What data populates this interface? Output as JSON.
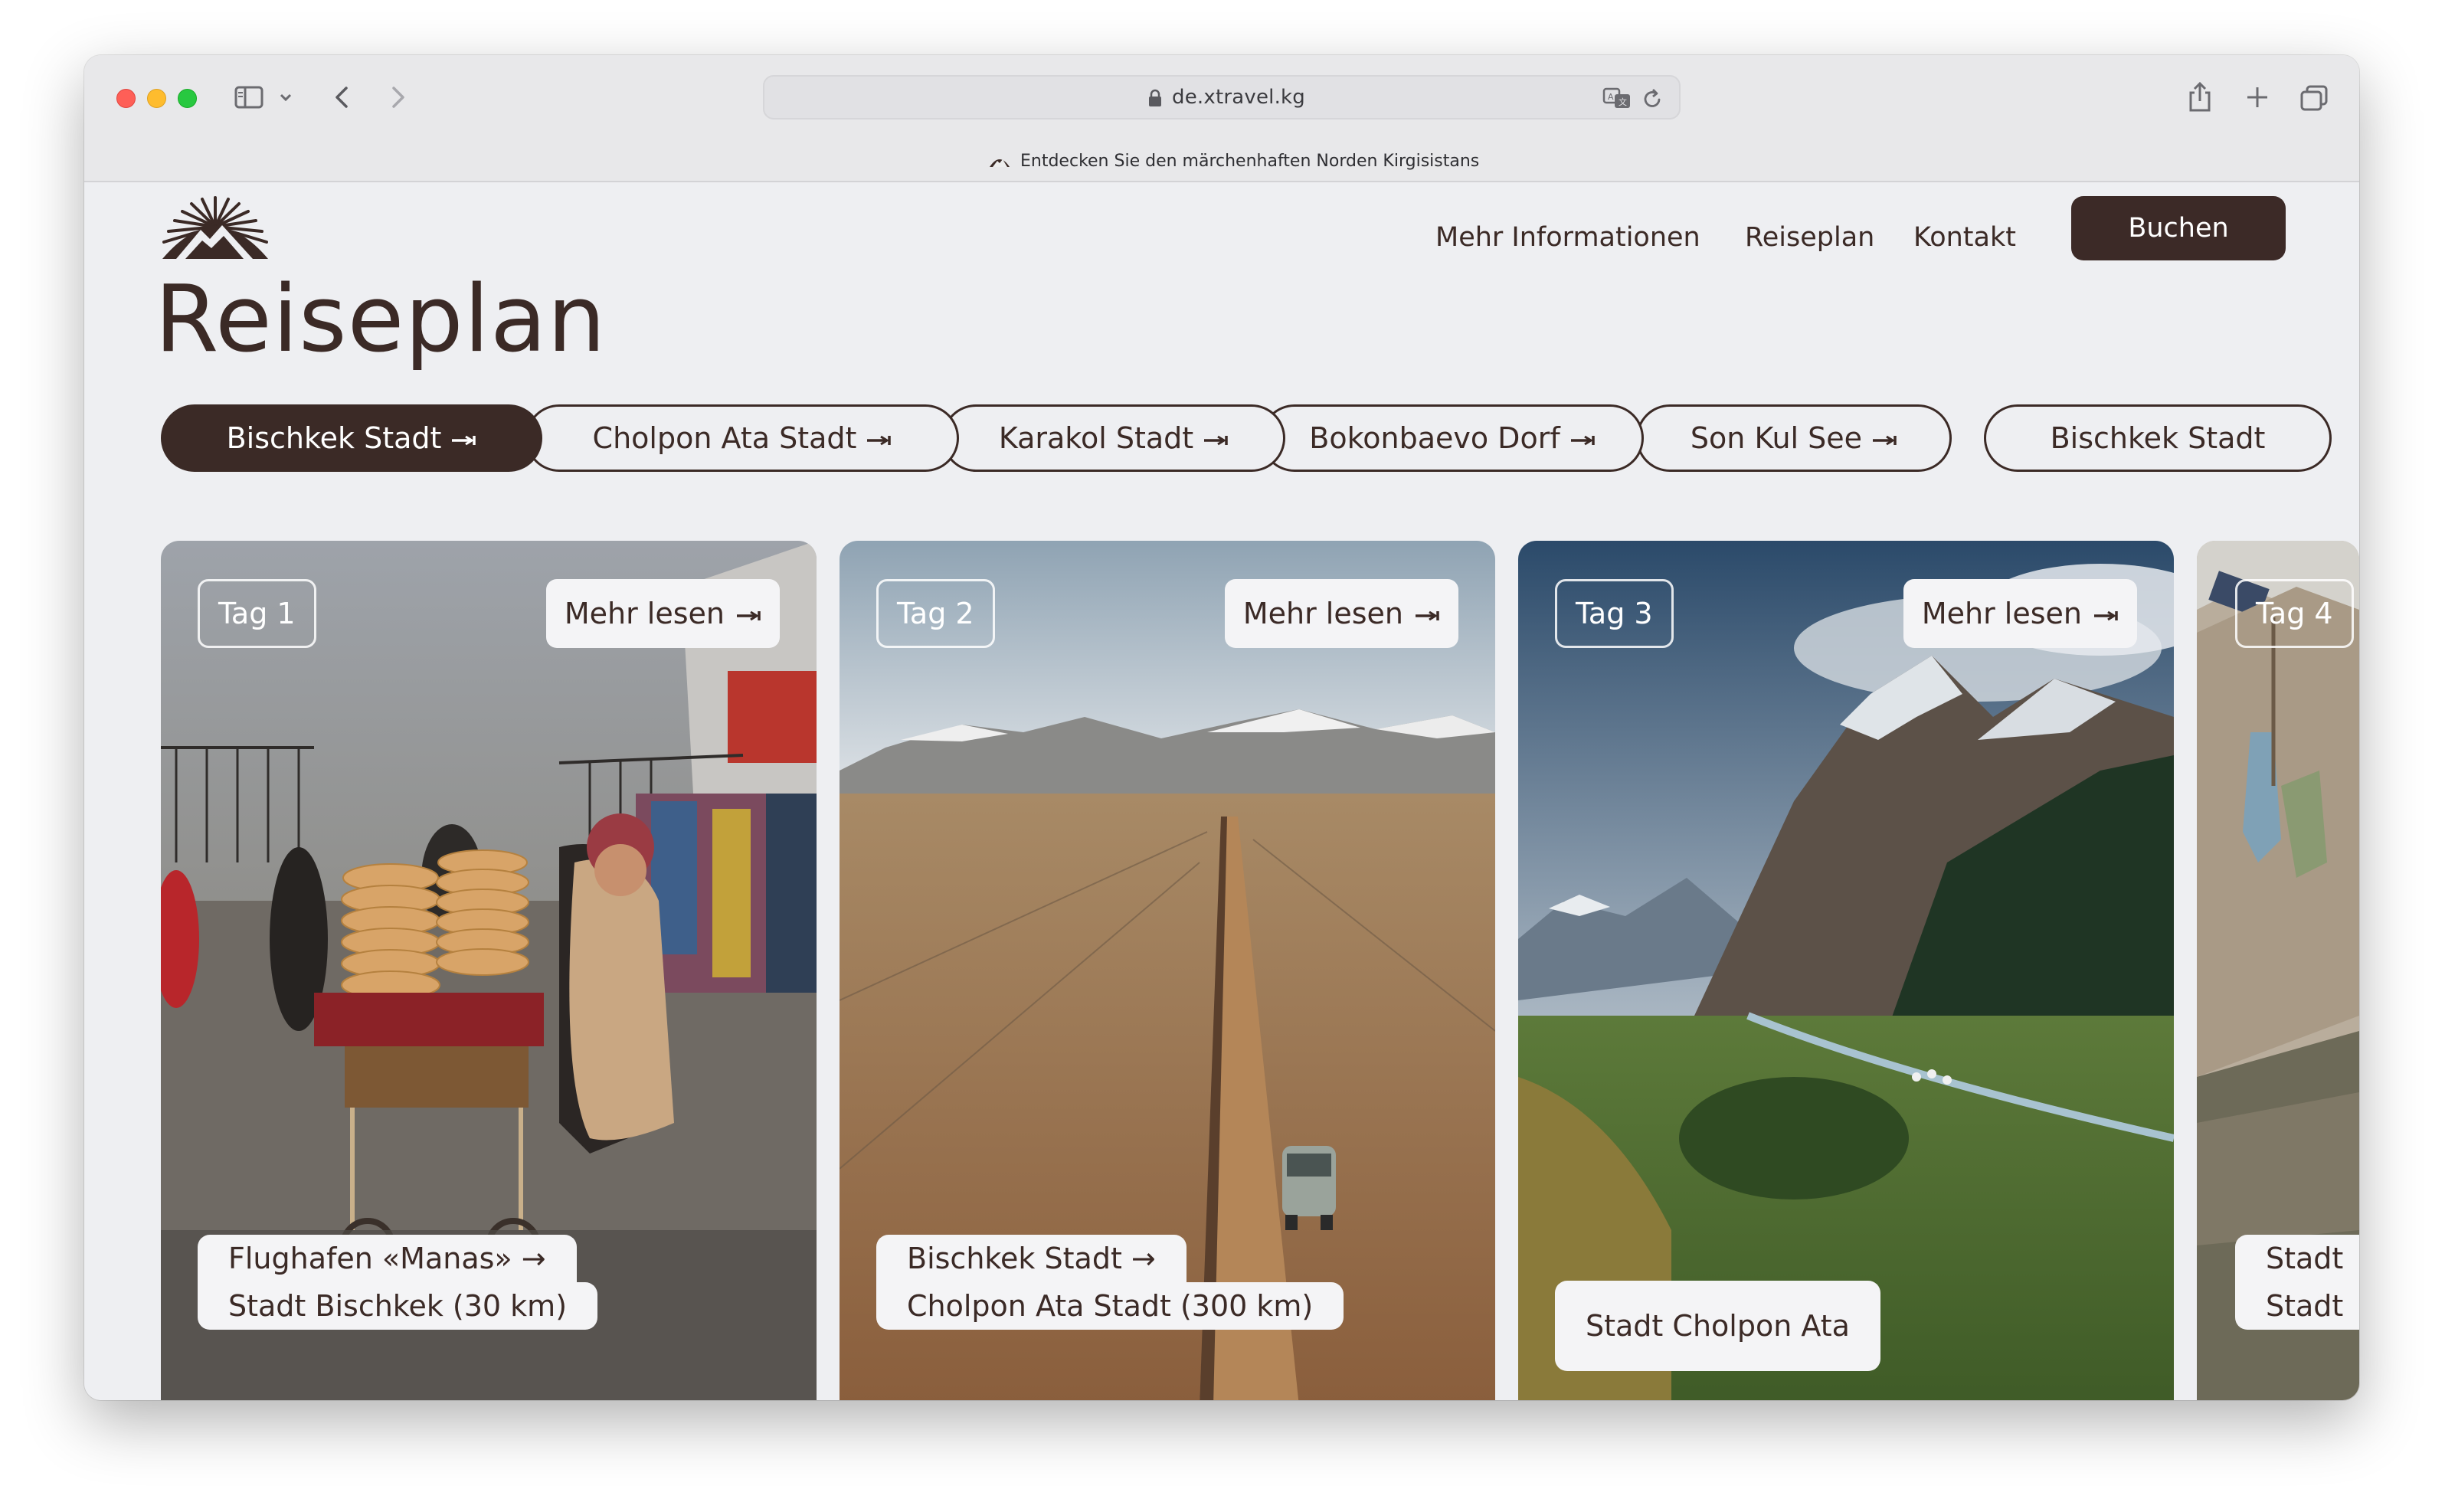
{
  "browser": {
    "url": "de.xtravel.kg",
    "tab_title": "Entdecken Sie den märchenhaften Norden Kirgisistans"
  },
  "header": {
    "nav": [
      "Mehr Informationen",
      "Reiseplan",
      "Kontakt"
    ],
    "book_label": "Buchen"
  },
  "page": {
    "title": "Reiseplan"
  },
  "route": [
    "Bischkek Stadt",
    "Cholpon Ata Stadt",
    "Karakol Stadt",
    "Bokonbaevo Dorf",
    "Son Kul See",
    "Bischkek Stadt"
  ],
  "cards": [
    {
      "day": "Tag 1",
      "more": "Mehr lesen",
      "line1": "Flughafen «Manas» →",
      "line2": "Stadt Bischkek (30 km)"
    },
    {
      "day": "Tag 2",
      "more": "Mehr lesen",
      "line1": "Bischkek Stadt →",
      "line2": "Cholpon Ata Stadt (300 km)"
    },
    {
      "day": "Tag 3",
      "more": "Mehr lesen",
      "line1": "",
      "line2": "Stadt Cholpon Ata"
    },
    {
      "day": "Tag 4",
      "more": "",
      "line1": "Stadt",
      "line2": "Stadt"
    }
  ],
  "colors": {
    "brand": "#3b2a26",
    "page_bg": "#eeeff2",
    "button_text": "#ffffff"
  }
}
